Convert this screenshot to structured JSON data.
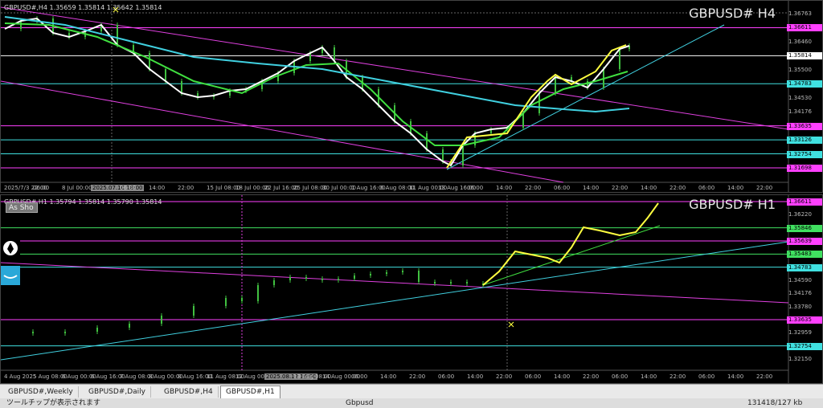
{
  "panes": {
    "h4": {
      "info": "GBPUSD#,H4  1.35659 1.35814 1.35642 1.35814",
      "title": "GBPUSD# H4",
      "prices": [
        {
          "value": "1.36763",
          "color": "#ffffff",
          "bg": "#000000"
        },
        {
          "value": "1.36611",
          "color": "#000000",
          "bg": "#ff40ff"
        },
        {
          "value": "1.36460",
          "color": "#bbbbbb",
          "bg": "#000000"
        },
        {
          "value": "1.35814",
          "color": "#000000",
          "bg": "#ffffff"
        },
        {
          "value": "1.35500",
          "color": "#bbbbbb",
          "bg": "#000000"
        },
        {
          "value": "1.34783",
          "color": "#000000",
          "bg": "#40e0e0"
        },
        {
          "value": "1.34530",
          "color": "#bbbbbb",
          "bg": "#000000"
        },
        {
          "value": "1.34176",
          "color": "#bbbbbb",
          "bg": "#000000"
        },
        {
          "value": "1.33635",
          "color": "#000000",
          "bg": "#ff40ff"
        },
        {
          "value": "1.33126",
          "color": "#000000",
          "bg": "#40e0e0"
        },
        {
          "value": "1.32754",
          "color": "#000000",
          "bg": "#40e0e0"
        },
        {
          "value": "1.31698",
          "color": "#000000",
          "bg": "#ff40ff"
        }
      ],
      "times": [
        {
          "t": "2025/7/3 22:00",
          "hl": false
        },
        {
          "t": "06:00",
          "hl": false
        },
        {
          "t": "8 Jul 00:00",
          "hl": false
        },
        {
          "t": "2025.07.10 18:00",
          "hl": true
        },
        {
          "t": "06:00",
          "hl": false
        },
        {
          "t": "14:00",
          "hl": false
        },
        {
          "t": "22:00",
          "hl": false
        },
        {
          "t": "15 Jul 08:00",
          "hl": false
        },
        {
          "t": "18 Jul 00:00",
          "hl": false
        },
        {
          "t": "22 Jul 16:00",
          "hl": false
        },
        {
          "t": "25 Jul 08:00",
          "hl": false
        },
        {
          "t": "30 Jul 00:00",
          "hl": false
        },
        {
          "t": "1 Aug 16:00",
          "hl": false
        },
        {
          "t": "6 Aug 08:00",
          "hl": false
        },
        {
          "t": "11 Aug 00:00",
          "hl": false
        },
        {
          "t": "13 Aug 16:00",
          "hl": false
        },
        {
          "t": "06:00",
          "hl": false
        },
        {
          "t": "14:00",
          "hl": false
        },
        {
          "t": "22:00",
          "hl": false
        },
        {
          "t": "06:00",
          "hl": false
        },
        {
          "t": "14:00",
          "hl": false
        },
        {
          "t": "22:00",
          "hl": false
        },
        {
          "t": "14:00",
          "hl": false
        },
        {
          "t": "22:00",
          "hl": false
        },
        {
          "t": "06:00",
          "hl": false
        },
        {
          "t": "14:00",
          "hl": false
        },
        {
          "t": "22:00",
          "hl": false
        }
      ],
      "crosshair_label": "2025.07.10 12:00"
    },
    "h1": {
      "info": "GBPUSD#,H1  1.35794 1.35814 1.35790 1.35814",
      "title": "GBPUSD# H1",
      "as_button": "As Sho",
      "prices": [
        {
          "value": "1.36611",
          "color": "#000000",
          "bg": "#ff40ff"
        },
        {
          "value": "1.36220",
          "color": "#bbbbbb",
          "bg": "#000000"
        },
        {
          "value": "1.35846",
          "color": "#000000",
          "bg": "#40e060"
        },
        {
          "value": "1.35639",
          "color": "#000000",
          "bg": "#ff40ff"
        },
        {
          "value": "1.35483",
          "color": "#000000",
          "bg": "#40e060"
        },
        {
          "value": "1.34783",
          "color": "#000000",
          "bg": "#40e0e0"
        },
        {
          "value": "1.34590",
          "color": "#bbbbbb",
          "bg": "#000000"
        },
        {
          "value": "1.34176",
          "color": "#bbbbbb",
          "bg": "#000000"
        },
        {
          "value": "1.33780",
          "color": "#bbbbbb",
          "bg": "#000000"
        },
        {
          "value": "1.33635",
          "color": "#000000",
          "bg": "#ff40ff"
        },
        {
          "value": "1.32959",
          "color": "#bbbbbb",
          "bg": "#000000"
        },
        {
          "value": "1.32754",
          "color": "#000000",
          "bg": "#40e0e0"
        },
        {
          "value": "1.32150",
          "color": "#bbbbbb",
          "bg": "#000000"
        }
      ],
      "times": [
        {
          "t": "4 Aug 2025",
          "hl": false
        },
        {
          "t": "5 Aug 08:00",
          "hl": false
        },
        {
          "t": "6 Aug 00:00",
          "hl": false
        },
        {
          "t": "6 Aug 16:00",
          "hl": false
        },
        {
          "t": "7 Aug 08:00",
          "hl": false
        },
        {
          "t": "8 Aug 00:00",
          "hl": false
        },
        {
          "t": "8 Aug 16:00",
          "hl": false
        },
        {
          "t": "11 Aug 08:00",
          "hl": false
        },
        {
          "t": "12 Aug 00:00",
          "hl": false
        },
        {
          "t": "2025.08.12 16:00",
          "hl": true
        },
        {
          "t": "13 Aug 08:00",
          "hl": false
        },
        {
          "t": "14 Aug 00:00",
          "hl": false
        },
        {
          "t": "06:00",
          "hl": false
        },
        {
          "t": "14:00",
          "hl": false
        },
        {
          "t": "22:00",
          "hl": false
        },
        {
          "t": "06:00",
          "hl": false
        },
        {
          "t": "14:00",
          "hl": false
        },
        {
          "t": "22:00",
          "hl": false
        },
        {
          "t": "06:00",
          "hl": false
        },
        {
          "t": "14:00",
          "hl": false
        },
        {
          "t": "22:00",
          "hl": false
        },
        {
          "t": "06:00",
          "hl": false
        },
        {
          "t": "14:00",
          "hl": false
        },
        {
          "t": "22:00",
          "hl": false
        },
        {
          "t": "06:00",
          "hl": false
        },
        {
          "t": "14:00",
          "hl": false
        },
        {
          "t": "22:00",
          "hl": false
        }
      ],
      "crosshair_label": "2025.08.12 22:00"
    }
  },
  "tabs": [
    {
      "label": "GBPUSD#,Weekly",
      "active": false
    },
    {
      "label": "GBPUSD#,Daily",
      "active": false
    },
    {
      "label": "GBPUSD#,H4",
      "active": false
    },
    {
      "label": "GBPUSD#,H1",
      "active": true
    }
  ],
  "status": {
    "left": "ツールチップが表示されます",
    "mid": "Gbpusd",
    "right": "131418/127 kb"
  },
  "colors": {
    "magenta": "#e040e0",
    "cyan": "#40d0e0",
    "green": "#40e040",
    "yellow": "#ffff40",
    "white": "#ffffff",
    "candle": "#40c040"
  },
  "icons": [
    "pen-icon",
    "wave-icon",
    "crosshair-icon"
  ]
}
